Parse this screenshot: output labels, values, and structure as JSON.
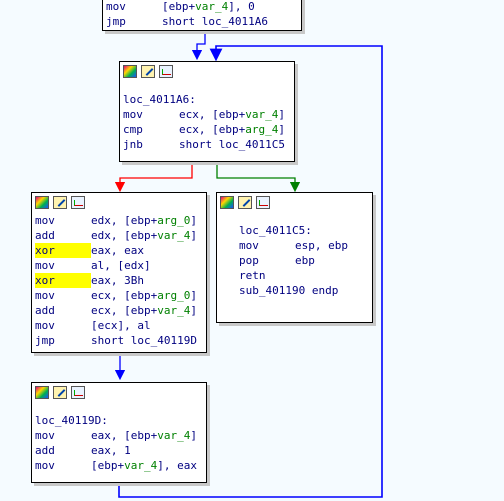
{
  "blocks": {
    "b0": {
      "lines": [
        {
          "mn": "mov",
          "pre": "[ebp+",
          "var": "var_4",
          "post": "], 0"
        },
        {
          "mn": "jmp",
          "pre": "short loc_4011A6",
          "var": "",
          "post": ""
        }
      ]
    },
    "b1": {
      "label": "loc_4011A6:",
      "lines": [
        {
          "mn": "mov",
          "pre": "ecx, [ebp+",
          "var": "var_4",
          "post": "]"
        },
        {
          "mn": "cmp",
          "pre": "ecx, [ebp+",
          "var": "arg_4",
          "post": "]"
        },
        {
          "mn": "jnb",
          "pre": "short loc_4011C5",
          "var": "",
          "post": ""
        }
      ]
    },
    "b2": {
      "lines": [
        {
          "mn": "mov",
          "pre": "edx, [ebp+",
          "var": "arg_0",
          "post": "]"
        },
        {
          "mn": "add",
          "pre": "edx, [ebp+",
          "var": "var_4",
          "post": "]"
        },
        {
          "mn": "xor",
          "pre": "eax, eax",
          "var": "",
          "post": ""
        },
        {
          "mn": "mov",
          "pre": "al, [edx]",
          "var": "",
          "post": ""
        },
        {
          "mn": "xor",
          "pre": "eax, 3Bh",
          "var": "",
          "post": ""
        },
        {
          "mn": "mov",
          "pre": "ecx, [ebp+",
          "var": "arg_0",
          "post": "]"
        },
        {
          "mn": "add",
          "pre": "ecx, [ebp+",
          "var": "var_4",
          "post": "]"
        },
        {
          "mn": "mov",
          "pre": "[ecx], al",
          "var": "",
          "post": ""
        },
        {
          "mn": "jmp",
          "pre": "short loc_40119D",
          "var": "",
          "post": ""
        }
      ]
    },
    "b3": {
      "label": "loc_4011C5:",
      "lines": [
        {
          "mn": "mov",
          "pre": "esp, ebp",
          "var": "",
          "post": ""
        },
        {
          "mn": "pop",
          "pre": "ebp",
          "var": "",
          "post": ""
        },
        {
          "mn": "retn",
          "pre": "",
          "var": "",
          "post": ""
        },
        {
          "mn": "sub_401190 endp",
          "pre": "",
          "var": "",
          "post": ""
        }
      ]
    },
    "b4": {
      "label": "loc_40119D:",
      "lines": [
        {
          "mn": "mov",
          "pre": "eax, [ebp+",
          "var": "var_4",
          "post": "]"
        },
        {
          "mn": "add",
          "pre": "eax, 1",
          "var": "",
          "post": ""
        },
        {
          "mn": "mov",
          "pre": "[ebp+",
          "var": "var_4",
          "post": "], eax"
        }
      ]
    }
  },
  "colors": {
    "edge_unconditional": "#0000ff",
    "edge_true": "#008000",
    "edge_false": "#ff0000",
    "mnemonic_highlight": "#ffff00",
    "background": "#f5fbff"
  },
  "icons": [
    "color-icon",
    "edit-icon",
    "graph-icon"
  ]
}
